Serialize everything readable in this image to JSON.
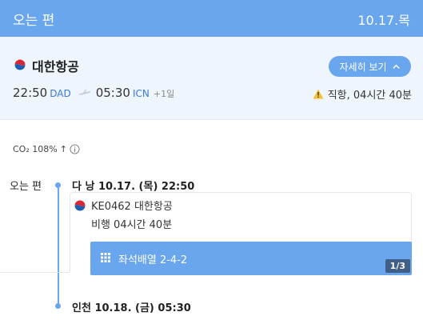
{
  "header": {
    "title": "오는 편",
    "date": "10.17.목"
  },
  "summary": {
    "airline": "대한항공",
    "detail_button": "자세히 보기",
    "departure": {
      "time": "22:50",
      "code": "DAD"
    },
    "arrival": {
      "time": "05:30",
      "code": "ICN",
      "day_offset": "+1일"
    },
    "nonstop": "직항, 04시간 40분"
  },
  "co2": {
    "label": "CO₂ 108%",
    "arrow": "↑"
  },
  "itinerary": {
    "leg_label": "오는 편",
    "departure": "다 낭 10.17. (목) 22:50",
    "arrival": "인천 10.18. (금) 05:30",
    "flight_number": "KE0462 대한항공",
    "duration": "비행 04시간 40분",
    "seat_layout": "좌석배열 2-4-2",
    "pager": "1/3"
  },
  "colors": {
    "accent": "#6aa6ee",
    "panel": "#eef5fd",
    "code": "#3a7bd5",
    "pager_bg": "#3f5f87"
  },
  "icons": [
    "korean-air-logo-icon",
    "chevron-up-icon",
    "plane-icon",
    "warning-icon",
    "info-icon",
    "seat-grid-icon"
  ]
}
